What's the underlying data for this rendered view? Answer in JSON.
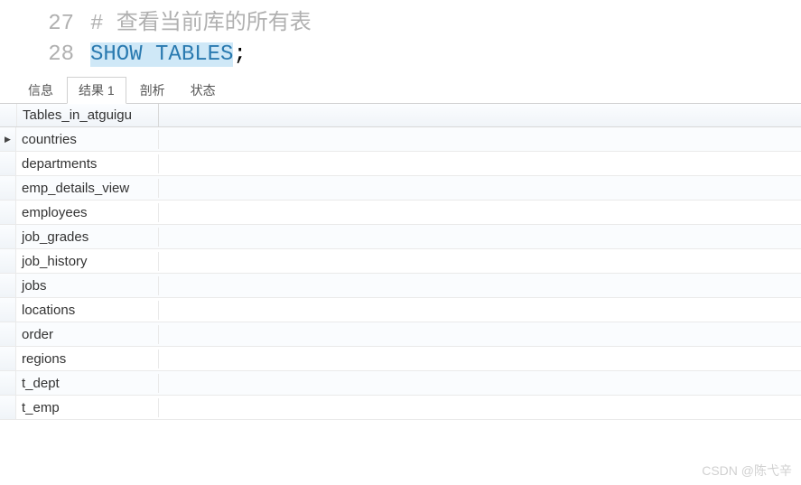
{
  "editor": {
    "lines": [
      {
        "number": "27",
        "comment": "# 查看当前库的所有表",
        "highlighted": false
      },
      {
        "number": "28",
        "sql": "SHOW TABLES",
        "tail": ";",
        "highlighted": true
      }
    ]
  },
  "tabs": {
    "items": [
      {
        "label": "信息",
        "active": false
      },
      {
        "label": "结果 1",
        "active": true
      },
      {
        "label": "剖析",
        "active": false
      },
      {
        "label": "状态",
        "active": false
      }
    ]
  },
  "grid": {
    "column_header": "Tables_in_atguigu",
    "rows": [
      {
        "value": "countries",
        "current": true
      },
      {
        "value": "departments",
        "current": false
      },
      {
        "value": "emp_details_view",
        "current": false
      },
      {
        "value": "employees",
        "current": false
      },
      {
        "value": "job_grades",
        "current": false
      },
      {
        "value": "job_history",
        "current": false
      },
      {
        "value": "jobs",
        "current": false
      },
      {
        "value": "locations",
        "current": false
      },
      {
        "value": "order",
        "current": false
      },
      {
        "value": "regions",
        "current": false
      },
      {
        "value": "t_dept",
        "current": false
      },
      {
        "value": "t_emp",
        "current": false
      }
    ]
  },
  "watermark": "CSDN @陈弋辛"
}
